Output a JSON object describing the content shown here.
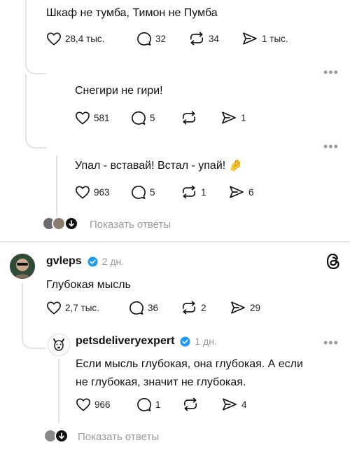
{
  "posts": [
    {
      "text": "Шкаф не тумба, Тимон не Пумба",
      "likes": "28,4 тыс.",
      "comments": "32",
      "reposts": "34",
      "shares": "1 тыс."
    },
    {
      "text": "Снегири не гири!",
      "likes": "581",
      "comments": "5",
      "reposts": "",
      "shares": "1"
    },
    {
      "text": "Упал - вставай! Встал - упай!",
      "emoji": "🤌",
      "likes": "963",
      "comments": "5",
      "reposts": "1",
      "shares": "6"
    },
    {
      "username": "gvleps",
      "time": "2 дн.",
      "text": "Глубокая мысль",
      "likes": "2,7 тыс.",
      "comments": "36",
      "reposts": "2",
      "shares": "29"
    },
    {
      "username": "petsdeliveryexpert",
      "time": "1 дн.",
      "text_line1": "Если мысль глубокая, она глубокая. А если",
      "text_line2": "не глубокая, значит не глубокая.",
      "likes": "966",
      "comments": "1",
      "reposts": "",
      "shares": "4"
    }
  ],
  "show_replies_label": "Показать ответы",
  "more_glyph": "•••",
  "colors": {
    "verified": "#1d9bf0",
    "muted": "#9a9a9a",
    "line": "#e3e3e3"
  }
}
